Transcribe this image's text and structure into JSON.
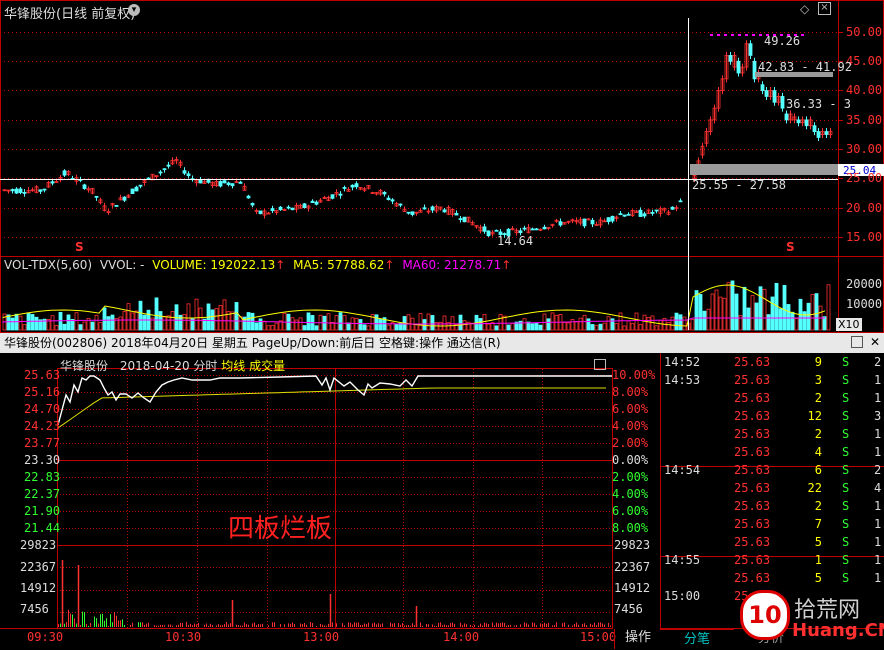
{
  "kline": {
    "title": "华锋股份(日线 前复权)",
    "price_axis": [
      "50.00",
      "45.00",
      "40.00",
      "35.00",
      "30.00",
      "25.00",
      "20.00",
      "15.00"
    ],
    "current_price_tag": "25.04",
    "annotations": {
      "high": "49.26",
      "range1": "42.83 - 41.92",
      "range2": "36.33 - 3",
      "range3": "25.55 - 27.58",
      "low": "14.64"
    },
    "s_marker": "S",
    "icons": [
      "diamond-icon",
      "close-icon"
    ]
  },
  "volume": {
    "indicator": "VOL-TDX(5,60)",
    "vvol": "VVOL: -",
    "volume_text": "VOLUME: 192022.13",
    "ma5_text": "MA5: 57788.62",
    "ma60_text": "MA60: 21278.71",
    "axis": [
      "20000",
      "10000"
    ],
    "unit": "X10",
    "colors": {
      "volume": "#dddddd",
      "ma5": "#ffff00",
      "ma60": "#ff00ff"
    }
  },
  "intraday_header": {
    "text": "华锋股份(002806)  2018年04月20日  星期五  PageUp/Down:前后日  空格键:操作  通达信(R)"
  },
  "intraday": {
    "label_name": "华锋股份",
    "label_date": "2018-04-20 分时",
    "avg_label": "均线",
    "vol_label": "成交量",
    "left_axis": [
      "25.63",
      "25.16",
      "24.70",
      "24.23",
      "23.77",
      "23.30",
      "22.83",
      "22.37",
      "21.90",
      "21.44"
    ],
    "right_axis": [
      "10.00%",
      "8.00%",
      "6.00%",
      "4.00%",
      "2.00%",
      "0.00%",
      "2.00%",
      "4.00%",
      "6.00%",
      "8.00%"
    ],
    "vol_axis": [
      "29823",
      "22367",
      "14912",
      "7456"
    ],
    "time_axis": [
      "09:30",
      "10:30",
      "13:00",
      "14:00",
      "15:00"
    ],
    "annotation": "四板烂板",
    "op_button": "操作"
  },
  "ticks": {
    "rows": [
      {
        "time": "14:52",
        "price": "25.63",
        "vol": "9",
        "side": "S",
        "num": "2"
      },
      {
        "time": "14:53",
        "price": "25.63",
        "vol": "3",
        "side": "S",
        "num": "1"
      },
      {
        "time": "",
        "price": "25.63",
        "vol": "2",
        "side": "S",
        "num": "1"
      },
      {
        "time": "",
        "price": "25.63",
        "vol": "12",
        "side": "S",
        "num": "3"
      },
      {
        "time": "",
        "price": "25.63",
        "vol": "2",
        "side": "S",
        "num": "1"
      },
      {
        "time": "",
        "price": "25.63",
        "vol": "4",
        "side": "S",
        "num": "1"
      },
      {
        "time": "14:54",
        "price": "25.63",
        "vol": "6",
        "side": "S",
        "num": "2"
      },
      {
        "time": "",
        "price": "25.63",
        "vol": "22",
        "side": "S",
        "num": "4"
      },
      {
        "time": "",
        "price": "25.63",
        "vol": "2",
        "side": "S",
        "num": "1"
      },
      {
        "time": "",
        "price": "25.63",
        "vol": "7",
        "side": "S",
        "num": "1"
      },
      {
        "time": "",
        "price": "25.63",
        "vol": "5",
        "side": "S",
        "num": "1"
      },
      {
        "time": "14:55",
        "price": "25.63",
        "vol": "1",
        "side": "S",
        "num": "1"
      },
      {
        "time": "",
        "price": "25.63",
        "vol": "5",
        "side": "S",
        "num": "1"
      },
      {
        "time": "15:00",
        "price": "25.63",
        "vol": "",
        "side": "",
        "num": ""
      }
    ],
    "tab_left": "分笔",
    "tab_right": "分价",
    "watermark_main": "拾荒网",
    "watermark_sub": "Huang.CN",
    "watermark_num": "10"
  }
}
